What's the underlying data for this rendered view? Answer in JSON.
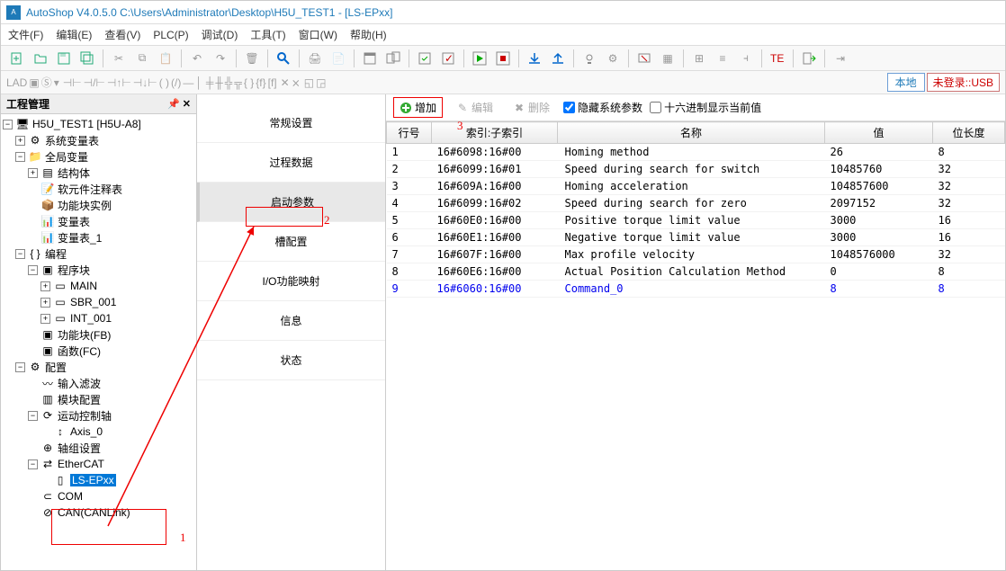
{
  "window": {
    "title": "AutoShop V4.0.5.0  C:\\Users\\Administrator\\Desktop\\H5U_TEST1 - [LS-EPxx]"
  },
  "menu": {
    "file": "文件(F)",
    "edit": "编辑(E)",
    "view": "查看(V)",
    "plc": "PLC(P)",
    "debug": "调试(D)",
    "tool": "工具(T)",
    "window": "窗口(W)",
    "help": "帮助(H)"
  },
  "statusButtons": {
    "local": "本地",
    "login": "未登录::USB"
  },
  "leftPanel": {
    "title": "工程管理",
    "pin": "📌 ✕"
  },
  "tree": {
    "root": "H5U_TEST1 [H5U-A8]",
    "sysvar": "系统变量表",
    "globalvar": "全局变量",
    "struct": "结构体",
    "comment": "软元件注释表",
    "fbinst": "功能块实例",
    "vartab": "变量表",
    "vartab1": "变量表_1",
    "prog": "编程",
    "progblk": "程序块",
    "main": "MAIN",
    "sbr": "SBR_001",
    "int": "INT_001",
    "fb": "功能块(FB)",
    "fc": "函数(FC)",
    "config": "配置",
    "infilt": "输入滤波",
    "modcfg": "模块配置",
    "motion": "运动控制轴",
    "axis0": "Axis_0",
    "axisgrp": "轴组设置",
    "ethercat": "EtherCAT",
    "lsepxx": "LS-EPxx",
    "com": "COM",
    "canlink": "CAN(CANLink)"
  },
  "midTabs": {
    "general": "常规设置",
    "process": "过程数据",
    "startup": "启动参数",
    "slot": "槽配置",
    "io": "I/O功能映射",
    "info": "信息",
    "status": "状态"
  },
  "rightToolbar": {
    "add": "增加",
    "edit": "编辑",
    "del": "删除",
    "hideSys": "隐藏系统参数",
    "hex": "十六进制显示当前值"
  },
  "grid": {
    "headers": {
      "row": "行号",
      "index": "索引:子索引",
      "name": "名称",
      "value": "值",
      "bitlen": "位长度"
    },
    "rows": [
      {
        "row": "1",
        "index": "16#6098:16#00",
        "name": "Homing method",
        "value": "26",
        "bitlen": "8",
        "blue": false
      },
      {
        "row": "2",
        "index": "16#6099:16#01",
        "name": "Speed during search for switch",
        "value": "10485760",
        "bitlen": "32",
        "blue": false
      },
      {
        "row": "3",
        "index": "16#609A:16#00",
        "name": "Homing acceleration",
        "value": "104857600",
        "bitlen": "32",
        "blue": false
      },
      {
        "row": "4",
        "index": "16#6099:16#02",
        "name": "Speed during search for zero",
        "value": "2097152",
        "bitlen": "32",
        "blue": false
      },
      {
        "row": "5",
        "index": "16#60E0:16#00",
        "name": "Positive torque limit value",
        "value": "3000",
        "bitlen": "16",
        "blue": false
      },
      {
        "row": "6",
        "index": "16#60E1:16#00",
        "name": "Negative torque limit value",
        "value": "3000",
        "bitlen": "16",
        "blue": false
      },
      {
        "row": "7",
        "index": "16#607F:16#00",
        "name": "Max profile velocity",
        "value": "1048576000",
        "bitlen": "32",
        "blue": false
      },
      {
        "row": "8",
        "index": "16#60E6:16#00",
        "name": "Actual Position Calculation Method",
        "value": "0",
        "bitlen": "8",
        "blue": false
      },
      {
        "row": "9",
        "index": "16#6060:16#00",
        "name": "Command_0",
        "value": "8",
        "bitlen": "8",
        "blue": true
      }
    ]
  },
  "annotations": {
    "a1": "1",
    "a2": "2",
    "a3": "3"
  }
}
